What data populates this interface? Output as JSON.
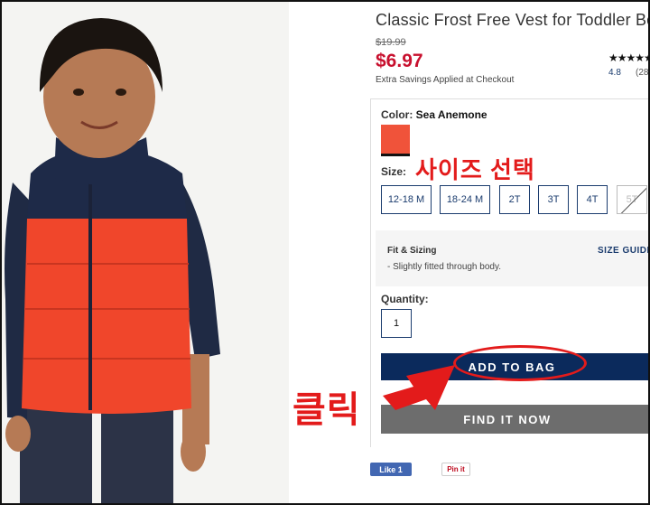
{
  "product": {
    "title": "Classic Frost Free Vest for Toddler Boys",
    "original_price": "$19.99",
    "price": "$6.97",
    "savings_note": "Extra Savings Applied at Checkout",
    "rating_stars": "★★★★★",
    "rating_score": "4.8",
    "rating_count": "(28"
  },
  "options": {
    "color_label": "Color:",
    "color_value": "Sea Anemone",
    "size_label": "Size:",
    "sizes": [
      "12-18 M",
      "18-24 M",
      "2T",
      "3T",
      "4T",
      "5T"
    ],
    "fit_title": "Fit & Sizing",
    "fit_text": "- Slightly fitted through body.",
    "size_guide": "SIZE GUIDE",
    "quantity_label": "Quantity:",
    "quantity_value": "1"
  },
  "actions": {
    "add_to_bag": "ADD TO BAG",
    "find_it_now": "FIND IT NOW",
    "fb_like": "Like 1",
    "pin_it": "Pin it"
  },
  "annotations": {
    "select_size": "사이즈 선택",
    "click": "클릭"
  },
  "colors": {
    "accent_red": "#e31b1b",
    "price_red": "#c8102e",
    "navy": "#0b2a5c",
    "swatch": "#f0533a"
  }
}
